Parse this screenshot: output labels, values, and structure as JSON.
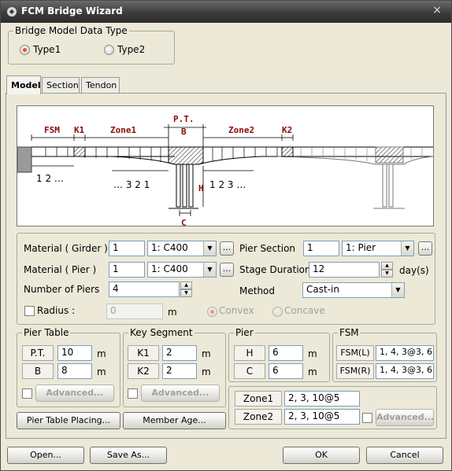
{
  "window": {
    "title": "FCM Bridge Wizard",
    "close_symbol": "×"
  },
  "model_type": {
    "legend": "Bridge Model Data Type",
    "option1": "Type1",
    "option2": "Type2",
    "selected": "Type1"
  },
  "tabs": [
    {
      "label": "Model"
    },
    {
      "label": "Section"
    },
    {
      "label": "Tendon"
    }
  ],
  "drawing": {
    "fsm": "FSM",
    "k1": "K1",
    "zone1": "Zone1",
    "pt": "P.T.",
    "b": "B",
    "zone2": "Zone2",
    "k2": "K2",
    "h": "H",
    "c": "C",
    "left_seq": "1 2 …",
    "mid_seq": "… 3 2 1",
    "right_seq": "1 2 3 …"
  },
  "form": {
    "material_girder_label": "Material ( Girder )",
    "material_girder_num": "1",
    "material_girder_val": "1: C400",
    "material_pier_label": "Material ( Pier )",
    "material_pier_num": "1",
    "material_pier_val": "1: C400",
    "num_piers_label": "Number of Piers",
    "num_piers_val": "4",
    "radius_label": "Radius :",
    "radius_val": "0",
    "radius_unit": "m",
    "convex": "Convex",
    "concave": "Concave",
    "pier_section_label": "Pier Section",
    "pier_section_num": "1",
    "pier_section_val": "1: Pier",
    "stage_duration_label": "Stage Duration",
    "stage_duration_val": "12",
    "stage_duration_unit": "day(s)",
    "method_label": "Method",
    "method_val": "Cast-in",
    "ellipsis": "..."
  },
  "pier_table": {
    "legend": "Pier Table",
    "pt_label": "P.T.",
    "pt_val": "10",
    "b_label": "B",
    "b_val": "8",
    "unit": "m",
    "advanced": "Advanced..."
  },
  "key_segment": {
    "legend": "Key Segment",
    "k1_label": "K1",
    "k1_val": "2",
    "k2_label": "K2",
    "k2_val": "2",
    "unit": "m",
    "advanced": "Advanced..."
  },
  "pier": {
    "legend": "Pier",
    "h_label": "H",
    "h_val": "6",
    "c_label": "C",
    "c_val": "6",
    "unit": "m"
  },
  "fsm": {
    "legend": "FSM",
    "l_label": "FSM(L)",
    "l_val": "1, 4, 3@3, 6",
    "r_label": "FSM(R)",
    "r_val": "1, 4, 3@3, 6"
  },
  "zones": {
    "zone1_label": "Zone1",
    "zone1_val": "2, 3, 10@5",
    "zone2_label": "Zone2",
    "zone2_val": "2, 3, 10@5",
    "advanced": "Advanced..."
  },
  "buttons": {
    "pier_table_placing": "Pier Table Placing...",
    "member_age": "Member Age...",
    "open": "Open...",
    "save_as": "Save As...",
    "ok": "OK",
    "cancel": "Cancel"
  }
}
